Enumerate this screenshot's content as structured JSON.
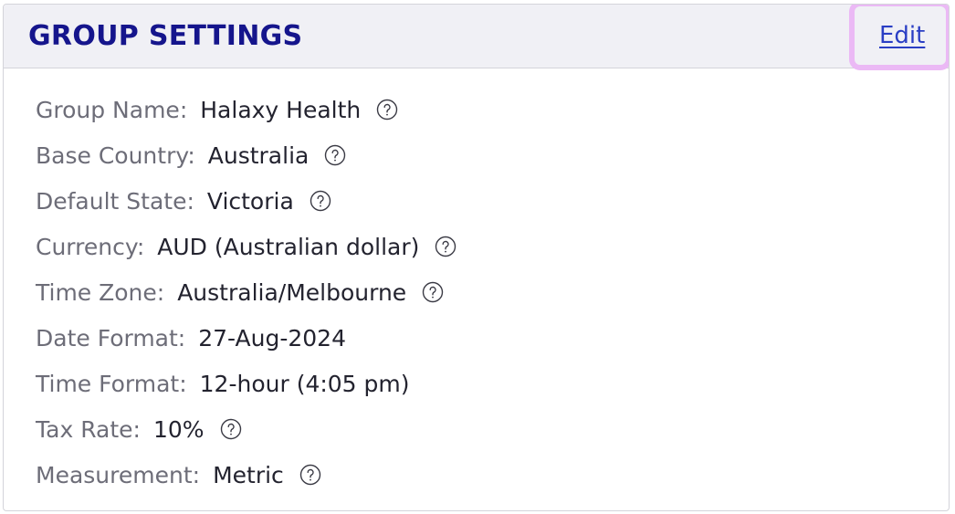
{
  "header": {
    "title": "GROUP SETTINGS",
    "edit_label": "Edit"
  },
  "colors": {
    "title": "#15158c",
    "link": "#2a3ec4",
    "focus_ring": "#ebb9f5",
    "header_bg": "#f0f0f5",
    "label": "#6d6d78",
    "value": "#23232f"
  },
  "settings": [
    {
      "label": "Group Name:",
      "value": "Halaxy Health",
      "help_icon": "question-circle-icon"
    },
    {
      "label": "Base Country:",
      "value": "Australia",
      "help_icon": "question-circle-icon"
    },
    {
      "label": "Default State:",
      "value": "Victoria",
      "help_icon": "question-circle-icon"
    },
    {
      "label": "Currency:",
      "value": "AUD (Australian dollar)",
      "help_icon": "question-circle-icon"
    },
    {
      "label": "Time Zone:",
      "value": "Australia/Melbourne",
      "help_icon": "question-circle-icon"
    },
    {
      "label": "Date Format:",
      "value": "27-Aug-2024"
    },
    {
      "label": "Time Format:",
      "value": "12-hour (4:05 pm)"
    },
    {
      "label": "Tax Rate:",
      "value": "10%",
      "help_icon": "question-circle-icon"
    },
    {
      "label": "Measurement:",
      "value": "Metric",
      "help_icon": "question-circle-icon"
    }
  ]
}
